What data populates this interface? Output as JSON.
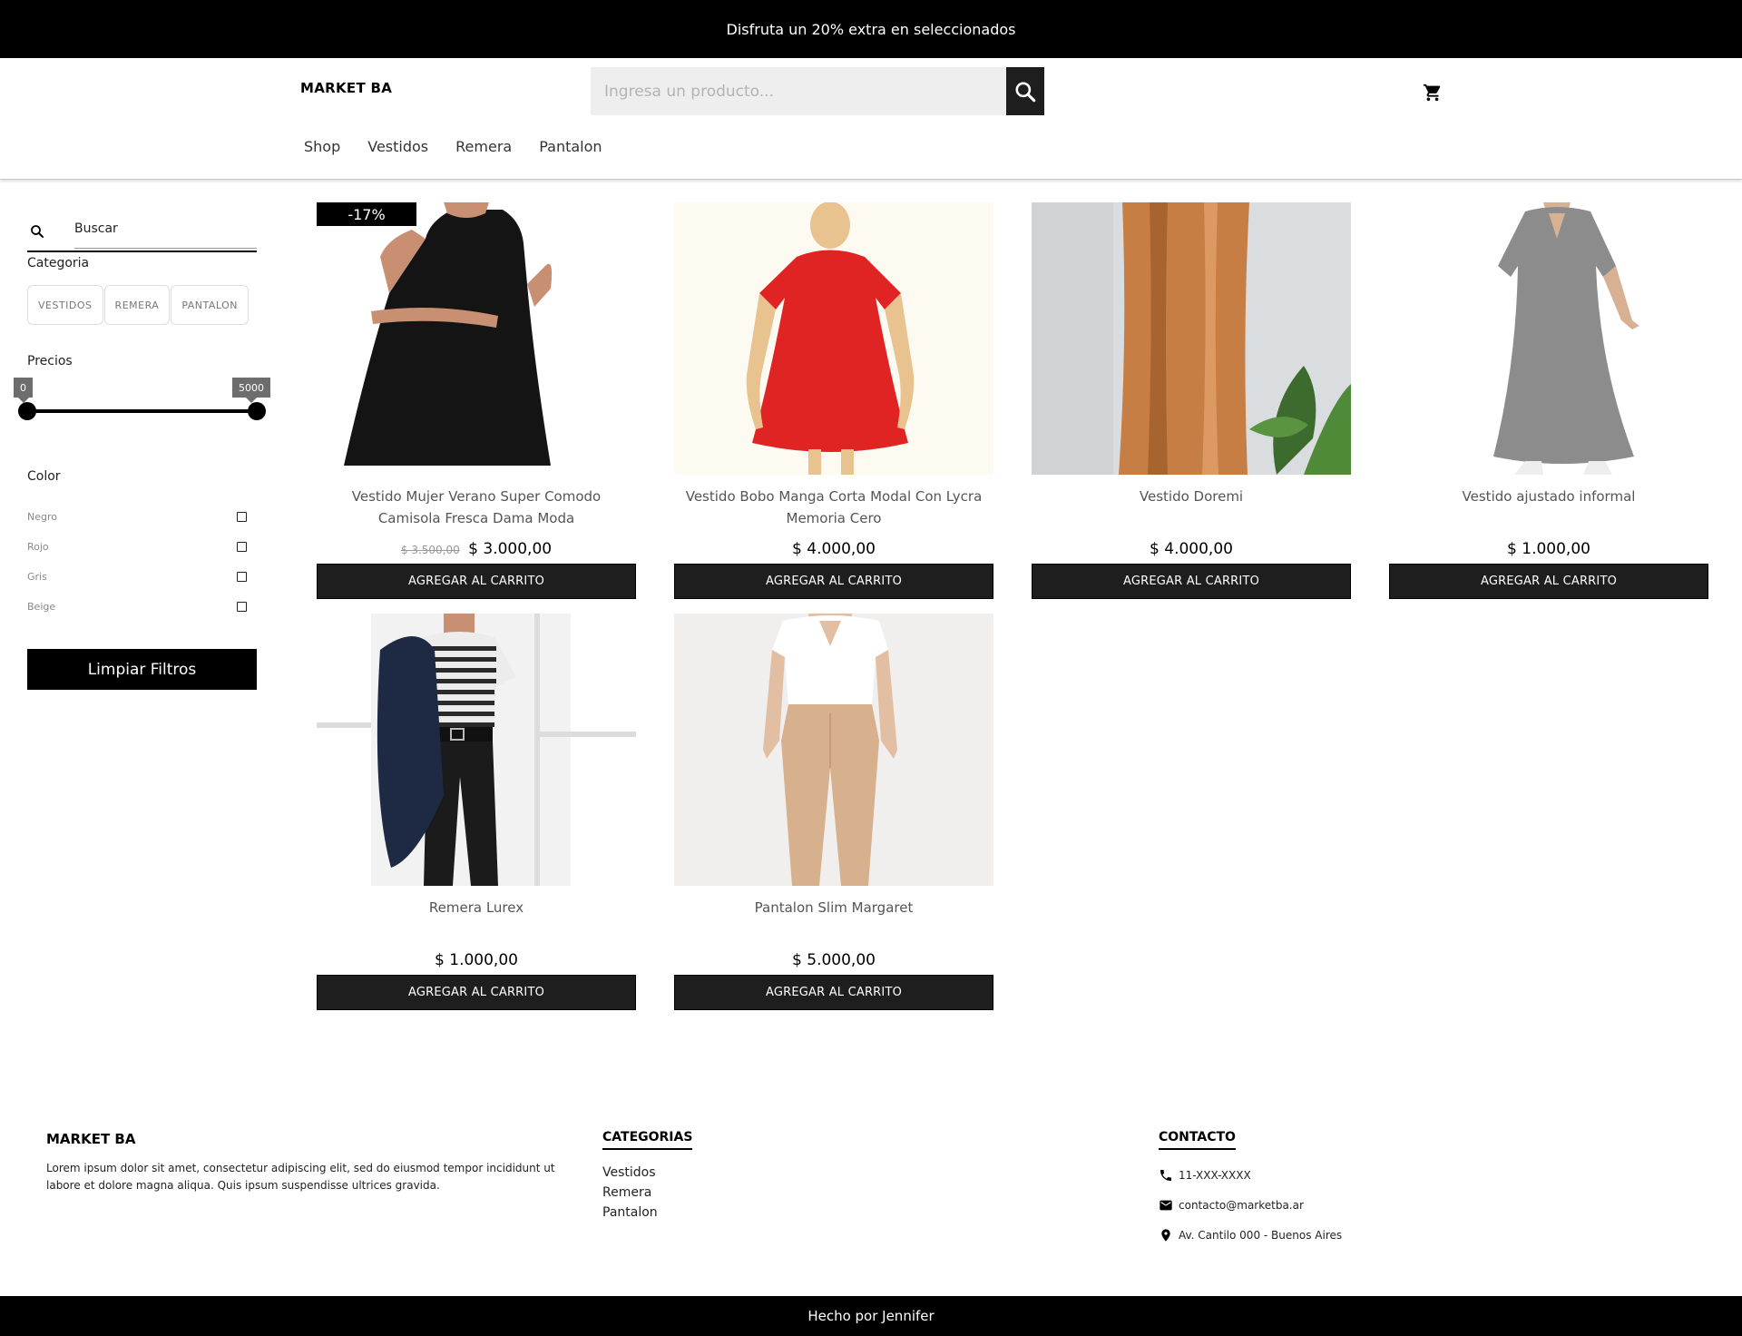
{
  "promo_bar": {
    "text": "Disfruta un 20% extra en seleccionados"
  },
  "header": {
    "logo": "MARKET BA",
    "search": {
      "placeholder": "Ingresa un producto...",
      "value": ""
    },
    "nav": [
      "Shop",
      "Vestidos",
      "Remera",
      "Pantalon"
    ]
  },
  "sidebar": {
    "search_placeholder": "Buscar",
    "category_title": "Categoria",
    "categories": [
      "VESTIDOS",
      "REMERA",
      "PANTALON"
    ],
    "price_title": "Precios",
    "price_min": "0",
    "price_max": "5000",
    "price_range_selected": [
      0,
      5000
    ],
    "color_title": "Color",
    "colors": [
      {
        "label": "Negro",
        "checked": false
      },
      {
        "label": "Rojo",
        "checked": false
      },
      {
        "label": "Gris",
        "checked": false
      },
      {
        "label": "Beige",
        "checked": false
      }
    ],
    "clear_label": "Limpiar Filtros"
  },
  "products": [
    {
      "name": "Vestido Mujer Verano Super Comodo Camisola Fresca Dama Moda",
      "old_price": "$ 3.500,00",
      "price": "$ 3.000,00",
      "badge": "-17%",
      "button": "AGREGAR AL CARRITO"
    },
    {
      "name": "Vestido Bobo Manga Corta Modal Con Lycra Memoria Cero",
      "old_price": "",
      "price": "$ 4.000,00",
      "badge": "",
      "button": "AGREGAR AL CARRITO"
    },
    {
      "name": "Vestido Doremi",
      "old_price": "",
      "price": "$ 4.000,00",
      "badge": "",
      "button": "AGREGAR AL CARRITO"
    },
    {
      "name": "Vestido ajustado informal",
      "old_price": "",
      "price": "$ 1.000,00",
      "badge": "",
      "button": "AGREGAR AL CARRITO"
    },
    {
      "name": "Remera Lurex",
      "old_price": "",
      "price": "$ 1.000,00",
      "badge": "",
      "button": "AGREGAR AL CARRITO"
    },
    {
      "name": "Pantalon Slim Margaret",
      "old_price": "",
      "price": "$ 5.000,00",
      "badge": "",
      "button": "AGREGAR AL CARRITO"
    }
  ],
  "footer": {
    "brand": "MARKET BA",
    "description": "Lorem ipsum dolor sit amet, consectetur adipiscing elit, sed do eiusmod tempor incididunt ut labore et dolore magna aliqua. Quis ipsum suspendisse ultrices gravida.",
    "categories_title": "CATEGORIAS",
    "categories": [
      "Vestidos",
      "Remera",
      "Pantalon"
    ],
    "contact_title": "CONTACTO",
    "phone": "11-XXX-XXXX",
    "email": "contacto@marketba.ar",
    "address": "Av. Cantilo 000 - Buenos Aires"
  },
  "bottom_bar": {
    "text": "Hecho por Jennifer"
  },
  "colors": {
    "dark": "#000000",
    "button": "#1e1e1e",
    "tooltip": "#6d6d6d",
    "input_bg": "#eeeeee"
  }
}
